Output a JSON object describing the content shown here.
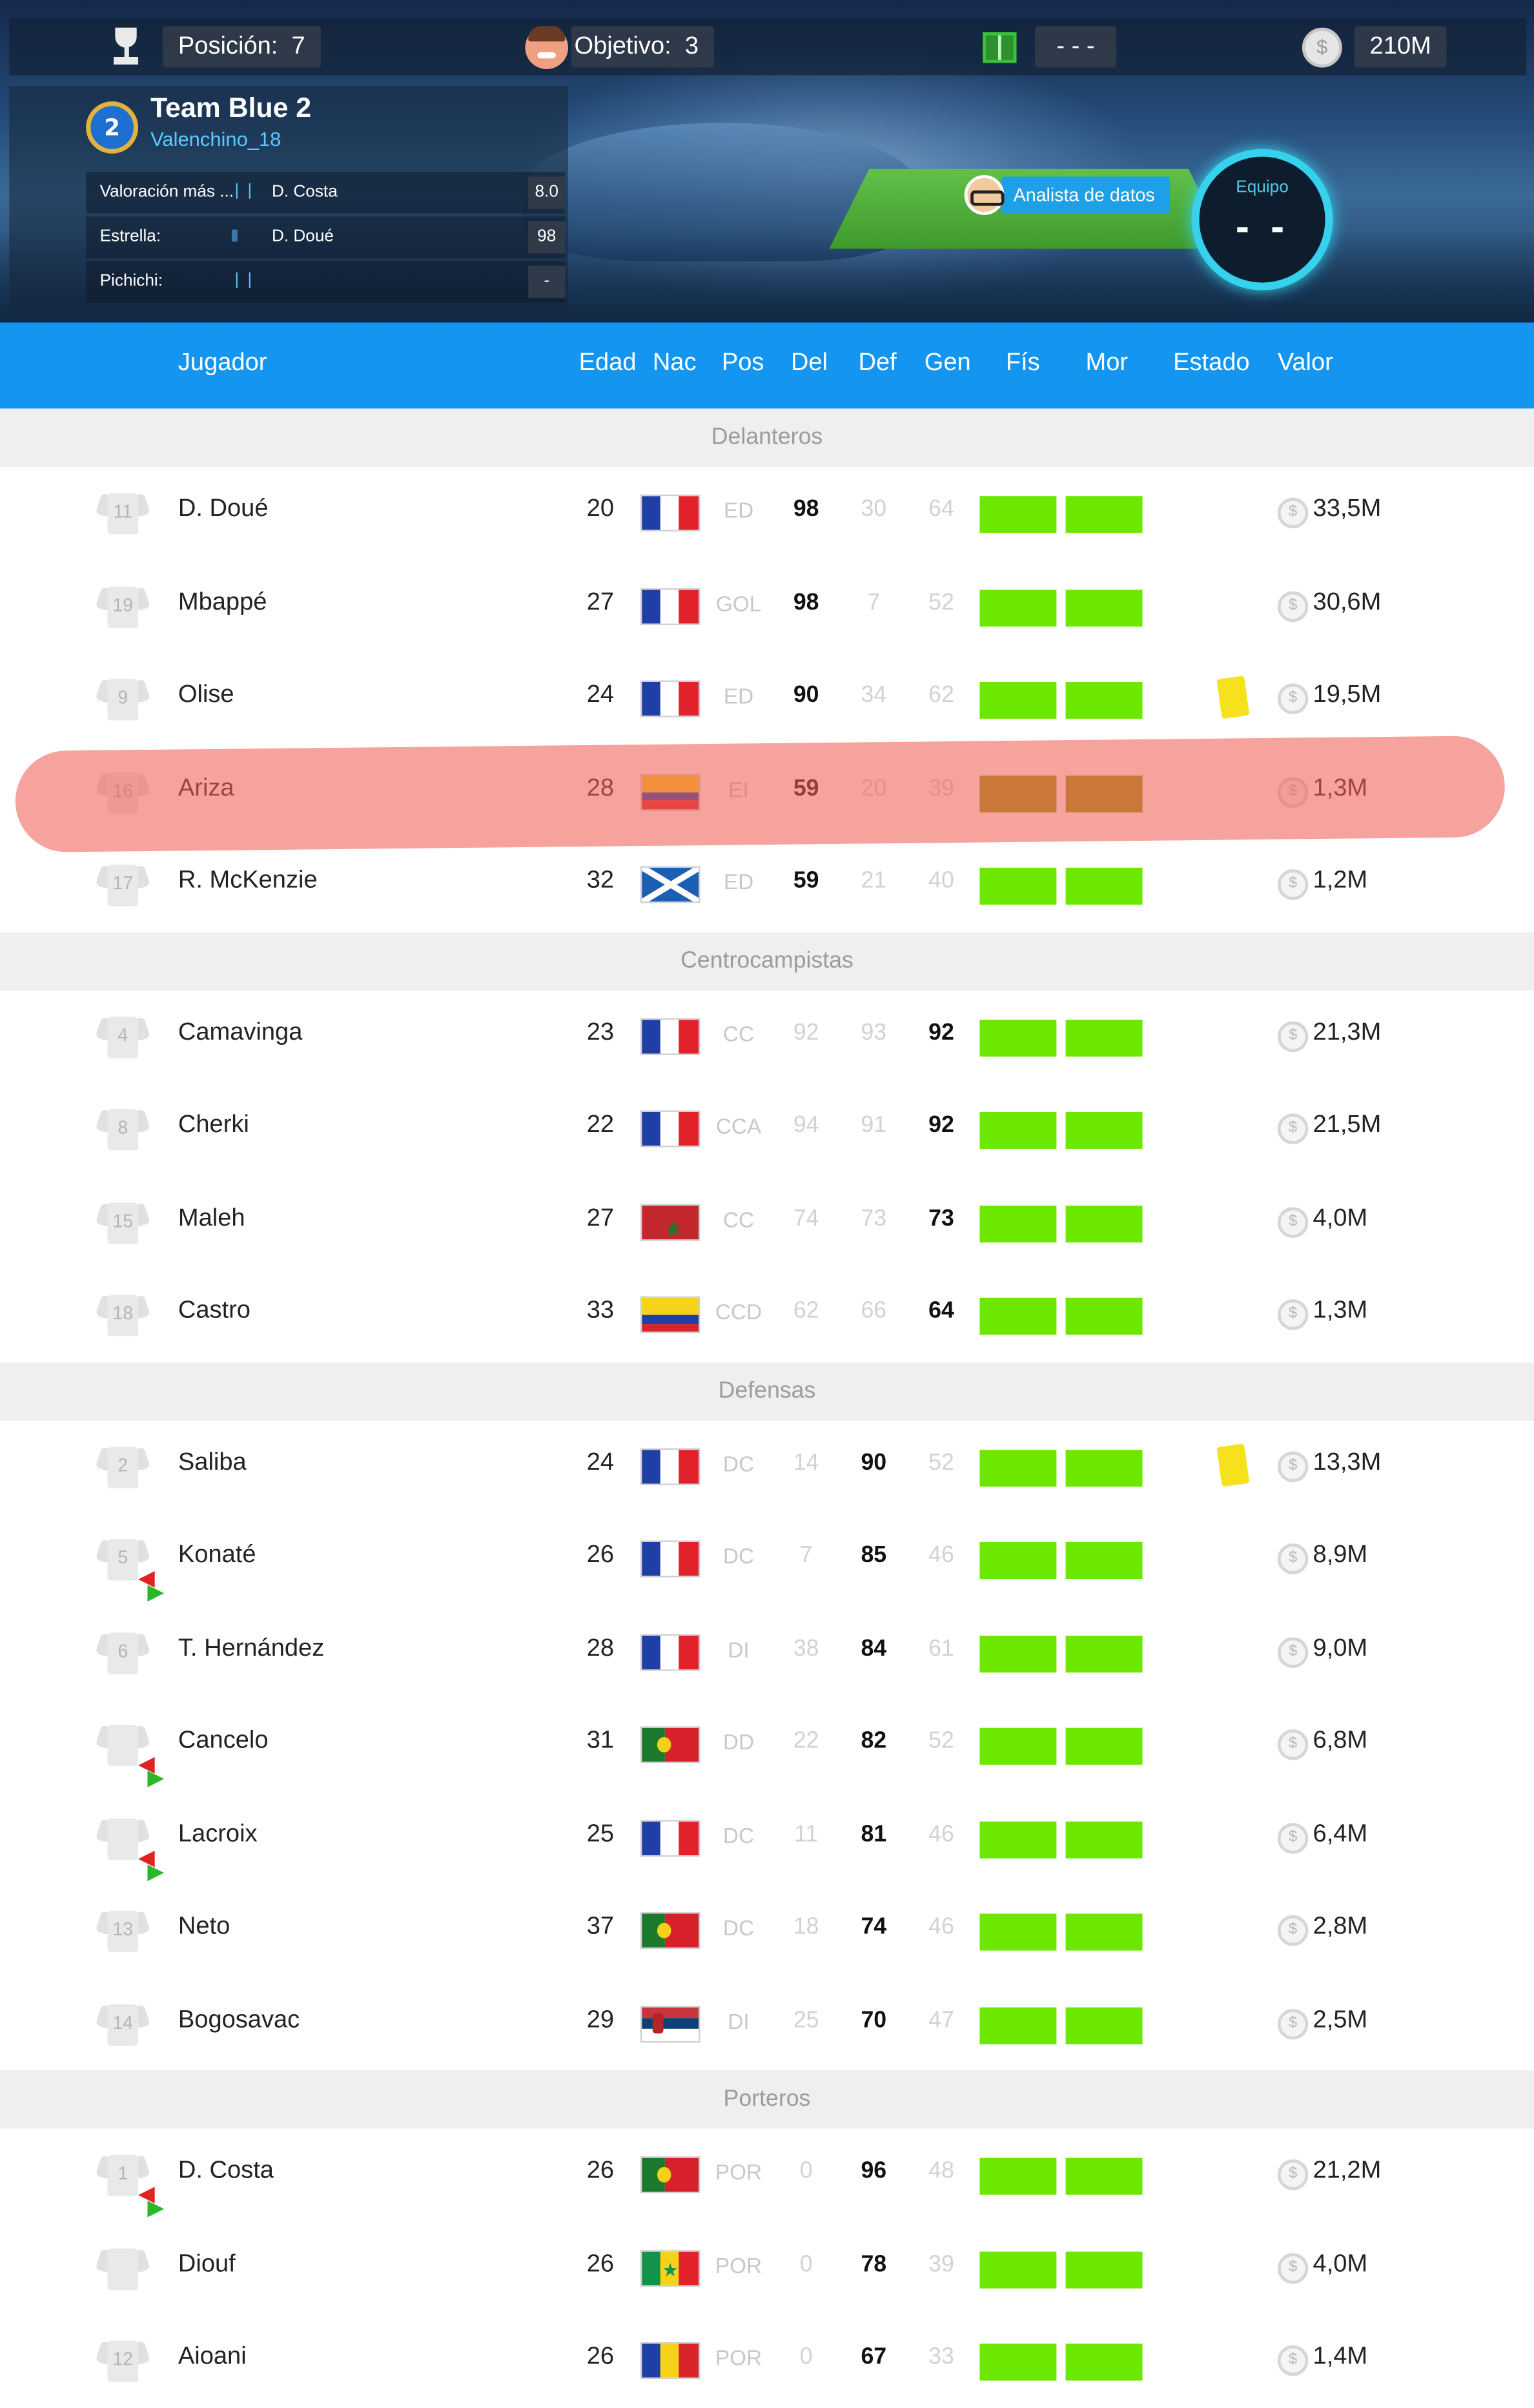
{
  "topbar": {
    "position_label": "Posición:",
    "position_value": "7",
    "objective_label": "Objetivo:",
    "objective_value": "3",
    "match_value": "- - -",
    "money": "210M",
    "coin_symbol": "$"
  },
  "team": {
    "badge_number": "2",
    "name": "Team Blue 2",
    "user": "Valenchino_18",
    "stats": [
      {
        "label": "Valoración más ...",
        "player": "D. Costa",
        "value": "8.0"
      },
      {
        "label": "Estrella:",
        "player": "D. Doué",
        "value": "98"
      },
      {
        "label": "Pichichi:",
        "player": "",
        "value": "-"
      }
    ],
    "analyst_label": "Analista de datos",
    "team_ring_label": "Equipo",
    "team_ring_value": "- -"
  },
  "columns": [
    "Jugador",
    "Edad",
    "Nac",
    "Pos",
    "Del",
    "Def",
    "Gen",
    "Fís",
    "Mor",
    "Estado",
    "Valor"
  ],
  "colors": {
    "header_blue": "#1496f0",
    "bar_green": "#6ce800",
    "bar_olive": "#9a9a14",
    "highlight_red": "#ee6054",
    "yellow_card": "#f5e21d",
    "section_bg": "#efefef"
  },
  "sections": [
    {
      "title": "Delanteros",
      "players": [
        {
          "num": "11",
          "name": "D. Doué",
          "age": "20",
          "nat": "fr",
          "pos": "ED",
          "del": "98",
          "def": "30",
          "gen": "64",
          "best": "del",
          "card": false,
          "transfer": false,
          "value": "33,5M"
        },
        {
          "num": "19",
          "name": "Mbappé",
          "age": "27",
          "nat": "fr",
          "pos": "GOL",
          "del": "98",
          "def": "7",
          "gen": "52",
          "best": "del",
          "card": false,
          "transfer": false,
          "value": "30,6M"
        },
        {
          "num": "9",
          "name": "Olise",
          "age": "24",
          "nat": "fr",
          "pos": "ED",
          "del": "90",
          "def": "34",
          "gen": "62",
          "best": "del",
          "card": true,
          "transfer": false,
          "value": "19,5M"
        },
        {
          "num": "16",
          "name": "Ariza",
          "age": "28",
          "nat": "co",
          "pos": "EI",
          "del": "59",
          "def": "20",
          "gen": "39",
          "best": "del",
          "card": false,
          "transfer": false,
          "value": "1,3M",
          "highlight": true
        },
        {
          "num": "17",
          "name": "R. McKenzie",
          "age": "32",
          "nat": "sc",
          "pos": "ED",
          "del": "59",
          "def": "21",
          "gen": "40",
          "best": "del",
          "card": false,
          "transfer": false,
          "value": "1,2M"
        }
      ]
    },
    {
      "title": "Centrocampistas",
      "players": [
        {
          "num": "4",
          "name": "Camavinga",
          "age": "23",
          "nat": "fr",
          "pos": "CC",
          "del": "92",
          "def": "93",
          "gen": "92",
          "best": "gen",
          "card": false,
          "transfer": false,
          "value": "21,3M"
        },
        {
          "num": "8",
          "name": "Cherki",
          "age": "22",
          "nat": "fr",
          "pos": "CCA",
          "del": "94",
          "def": "91",
          "gen": "92",
          "best": "gen",
          "card": false,
          "transfer": false,
          "value": "21,5M"
        },
        {
          "num": "15",
          "name": "Maleh",
          "age": "27",
          "nat": "ma",
          "pos": "CC",
          "del": "74",
          "def": "73",
          "gen": "73",
          "best": "gen",
          "card": false,
          "transfer": false,
          "value": "4,0M"
        },
        {
          "num": "18",
          "name": "Castro",
          "age": "33",
          "nat": "co",
          "pos": "CCD",
          "del": "62",
          "def": "66",
          "gen": "64",
          "best": "gen",
          "card": false,
          "transfer": false,
          "value": "1,3M"
        }
      ]
    },
    {
      "title": "Defensas",
      "players": [
        {
          "num": "2",
          "name": "Saliba",
          "age": "24",
          "nat": "fr",
          "pos": "DC",
          "del": "14",
          "def": "90",
          "gen": "52",
          "best": "def",
          "card": true,
          "transfer": false,
          "value": "13,3M"
        },
        {
          "num": "5",
          "name": "Konaté",
          "age": "26",
          "nat": "fr",
          "pos": "DC",
          "del": "7",
          "def": "85",
          "gen": "46",
          "best": "def",
          "card": false,
          "transfer": true,
          "value": "8,9M"
        },
        {
          "num": "6",
          "name": "T. Hernández",
          "age": "28",
          "nat": "fr",
          "pos": "DI",
          "del": "38",
          "def": "84",
          "gen": "61",
          "best": "def",
          "card": false,
          "transfer": false,
          "value": "9,0M"
        },
        {
          "num": "",
          "name": "Cancelo",
          "age": "31",
          "nat": "pt",
          "pos": "DD",
          "del": "22",
          "def": "82",
          "gen": "52",
          "best": "def",
          "card": false,
          "transfer": true,
          "value": "6,8M"
        },
        {
          "num": "",
          "name": "Lacroix",
          "age": "25",
          "nat": "fr",
          "pos": "DC",
          "del": "11",
          "def": "81",
          "gen": "46",
          "best": "def",
          "card": false,
          "transfer": true,
          "value": "6,4M"
        },
        {
          "num": "13",
          "name": "Neto",
          "age": "37",
          "nat": "pt",
          "pos": "DC",
          "del": "18",
          "def": "74",
          "gen": "46",
          "best": "def",
          "card": false,
          "transfer": false,
          "value": "2,8M"
        },
        {
          "num": "14",
          "name": "Bogosavac",
          "age": "29",
          "nat": "rs",
          "pos": "DI",
          "del": "25",
          "def": "70",
          "gen": "47",
          "best": "def",
          "card": false,
          "transfer": false,
          "value": "2,5M"
        }
      ]
    },
    {
      "title": "Porteros",
      "players": [
        {
          "num": "1",
          "name": "D. Costa",
          "age": "26",
          "nat": "pt",
          "pos": "POR",
          "del": "0",
          "def": "96",
          "gen": "48",
          "best": "def",
          "card": false,
          "transfer": true,
          "value": "21,2M"
        },
        {
          "num": "",
          "name": "Diouf",
          "age": "26",
          "nat": "sn",
          "pos": "POR",
          "del": "0",
          "def": "78",
          "gen": "39",
          "best": "def",
          "card": false,
          "transfer": false,
          "value": "4,0M"
        },
        {
          "num": "12",
          "name": "Aioani",
          "age": "26",
          "nat": "ro",
          "pos": "POR",
          "del": "0",
          "def": "67",
          "gen": "33",
          "best": "def",
          "card": false,
          "transfer": false,
          "value": "1,4M"
        }
      ]
    }
  ]
}
